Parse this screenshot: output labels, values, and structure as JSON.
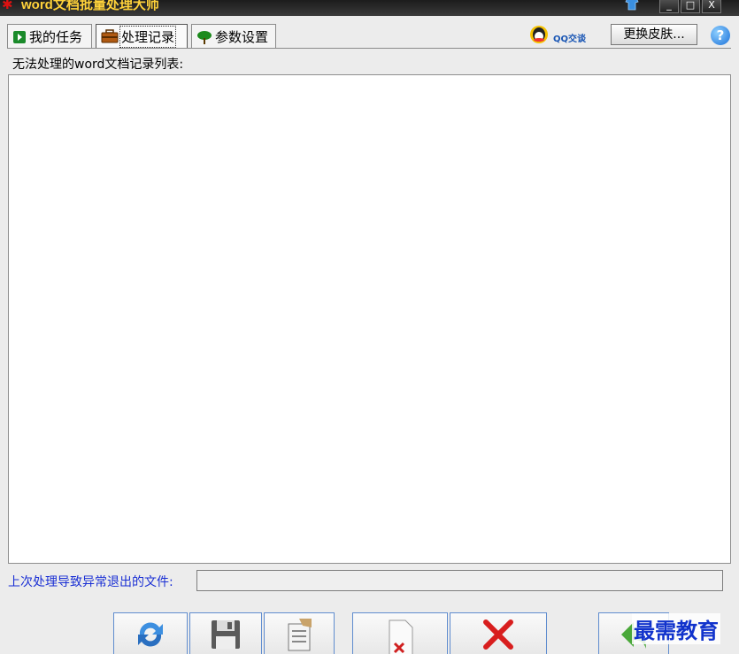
{
  "window": {
    "title": "word文档批量处理大师",
    "controls": {
      "minimize": "_",
      "maximize": "□",
      "close": "X"
    }
  },
  "tabs": [
    {
      "label": "我的任务",
      "icon": "play-icon",
      "active": false
    },
    {
      "label": "处理记录",
      "icon": "briefcase-icon",
      "active": true
    },
    {
      "label": "参数设置",
      "icon": "tree-icon",
      "active": false
    }
  ],
  "header": {
    "qq_label": "QQ交谈",
    "skin_button": "更换皮肤...",
    "help": "?"
  },
  "records": {
    "caption": "无法处理的word文档记录列表:",
    "items": []
  },
  "last_file": {
    "label": "上次处理导致异常退出的文件:",
    "value": ""
  },
  "toolbar": [
    {
      "icon": "refresh-icon"
    },
    {
      "icon": "save-icon"
    },
    {
      "icon": "document-list-icon"
    },
    {
      "icon": "delete-file-icon"
    },
    {
      "icon": "red-x-icon"
    },
    {
      "icon": "back-arrow-icon"
    }
  ],
  "watermark": "最需教育",
  "colors": {
    "title_text": "#ffd23a",
    "link_blue": "#1a2fd4",
    "button_border": "#5f8ccf"
  }
}
